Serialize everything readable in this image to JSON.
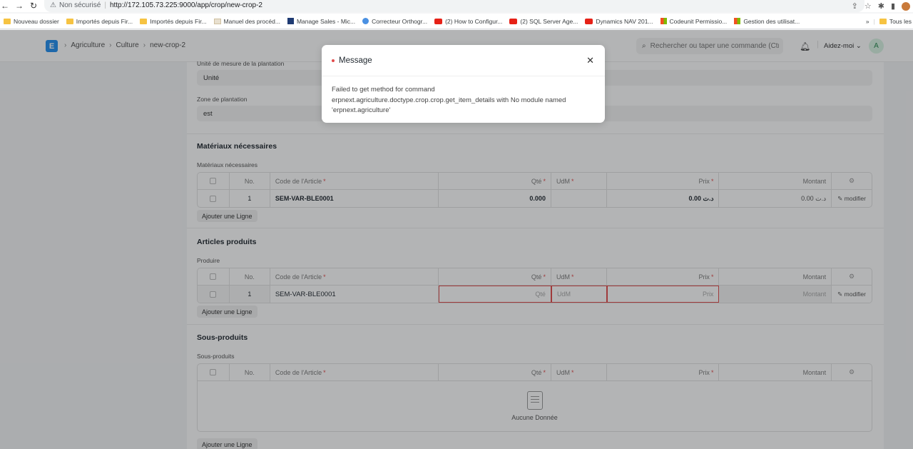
{
  "browser": {
    "security_label": "Non sécurisé",
    "url": "http://172.105.73.225:9000/app/crop/new-crop-2",
    "bookmarks": [
      {
        "label": "Nouveau dossier",
        "icon": "folder-icon"
      },
      {
        "label": "Importés depuis Fir...",
        "icon": "folder-icon"
      },
      {
        "label": "Importés depuis Fir...",
        "icon": "folder-icon"
      },
      {
        "label": "Manuel des procéd...",
        "icon": "doc-icon"
      },
      {
        "label": "Manage Sales - Mic...",
        "icon": "chart-icon"
      },
      {
        "label": "Correcteur Orthogr...",
        "icon": "globe-icon"
      },
      {
        "label": "(2) How to Configur...",
        "icon": "youtube-icon"
      },
      {
        "label": "(2) SQL Server Age...",
        "icon": "youtube-icon"
      },
      {
        "label": "Dynamics NAV 201...",
        "icon": "youtube-icon"
      },
      {
        "label": "Codeunit Permissio...",
        "icon": "microsoft-icon"
      },
      {
        "label": "Gestion des utilisat...",
        "icon": "microsoft-icon"
      }
    ],
    "bookmarks_overflow": "»",
    "all_bookmarks": "Tous les"
  },
  "navbar": {
    "logo_letter": "E",
    "breadcrumbs": [
      "Agriculture",
      "Culture",
      "new-crop-2"
    ],
    "search_placeholder": "Rechercher ou taper une commande (Ctr",
    "help_label": "Aidez-moi",
    "user_initial": "A"
  },
  "form": {
    "unit_label": "Unité de mesure de la plantation",
    "unit_value": "Unité",
    "zone_label": "Zone de plantation",
    "zone_value": "est"
  },
  "table_headers": {
    "no": "No.",
    "code": "Code de l'Article",
    "qty": "Qté",
    "udm": "UdM",
    "prix": "Prix",
    "montant": "Montant"
  },
  "materials": {
    "section_title": "Matériaux nécessaires",
    "table_label": "Matériaux nécessaires",
    "rows": [
      {
        "no": "1",
        "code": "SEM-VAR-BLE0001",
        "qty": "0.000",
        "udm": "",
        "prix": "0.00 د.ت",
        "montant": "0.00 د.ت",
        "edit": "modifier"
      }
    ],
    "add_row": "Ajouter une Ligne"
  },
  "produced": {
    "section_title": "Articles produits",
    "table_label": "Produire",
    "rows": [
      {
        "no": "1",
        "code": "SEM-VAR-BLE0001",
        "qty_placeholder": "Qté",
        "udm_placeholder": "UdM",
        "prix_placeholder": "Prix",
        "montant_placeholder": "Montant",
        "edit": "modifier"
      }
    ],
    "add_row": "Ajouter une Ligne"
  },
  "byproducts": {
    "section_title": "Sous-produits",
    "table_label": "Sous-produits",
    "empty_text": "Aucune Donnée",
    "add_row": "Ajouter une Ligne"
  },
  "modal": {
    "title": "Message",
    "body": "Failed to get method for command erpnext.agriculture.doctype.crop.crop.get_item_details with No module named 'erpnext.agriculture'"
  }
}
